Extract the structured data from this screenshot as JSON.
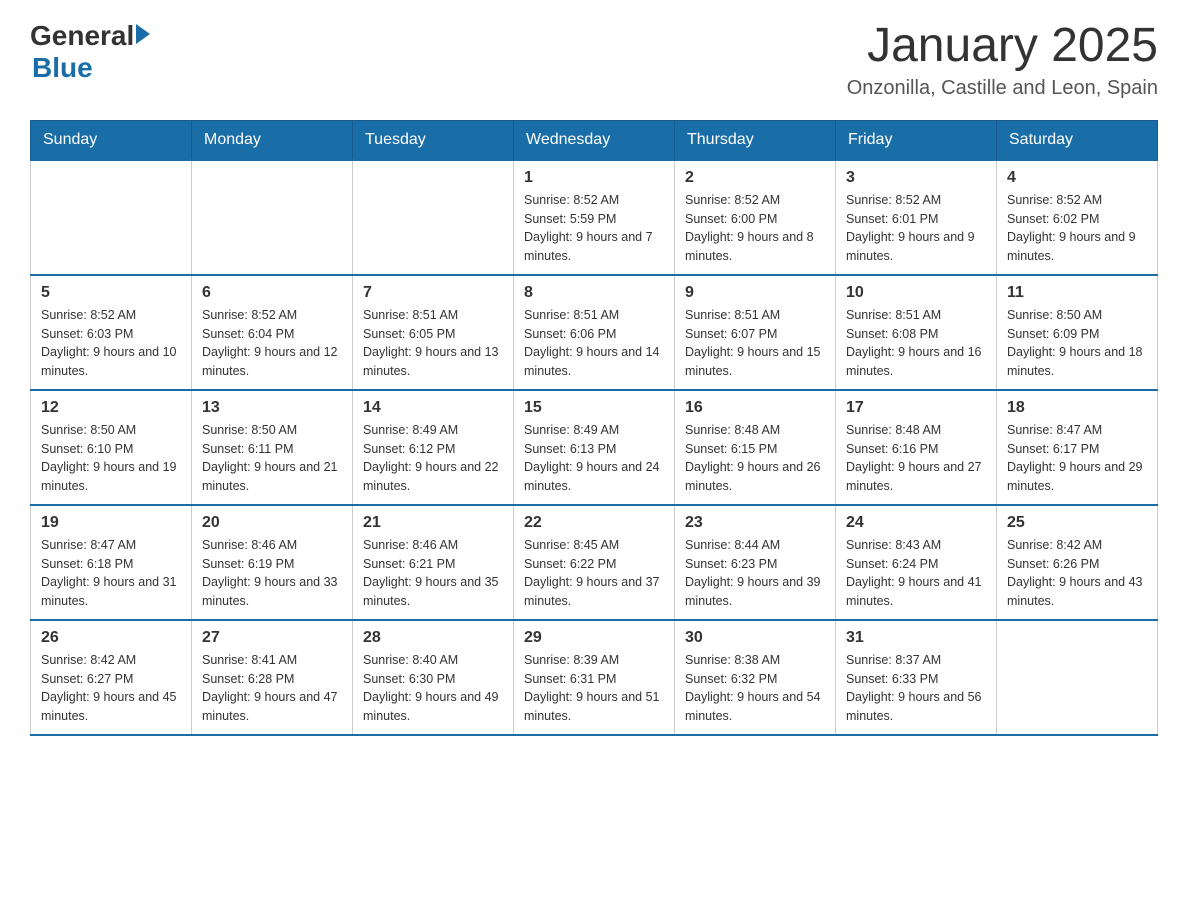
{
  "header": {
    "logo_general": "General",
    "logo_blue": "Blue",
    "title": "January 2025",
    "subtitle": "Onzonilla, Castille and Leon, Spain"
  },
  "days_of_week": [
    "Sunday",
    "Monday",
    "Tuesday",
    "Wednesday",
    "Thursday",
    "Friday",
    "Saturday"
  ],
  "weeks": [
    [
      {
        "date": "",
        "info": ""
      },
      {
        "date": "",
        "info": ""
      },
      {
        "date": "",
        "info": ""
      },
      {
        "date": "1",
        "info": "Sunrise: 8:52 AM\nSunset: 5:59 PM\nDaylight: 9 hours and 7 minutes."
      },
      {
        "date": "2",
        "info": "Sunrise: 8:52 AM\nSunset: 6:00 PM\nDaylight: 9 hours and 8 minutes."
      },
      {
        "date": "3",
        "info": "Sunrise: 8:52 AM\nSunset: 6:01 PM\nDaylight: 9 hours and 9 minutes."
      },
      {
        "date": "4",
        "info": "Sunrise: 8:52 AM\nSunset: 6:02 PM\nDaylight: 9 hours and 9 minutes."
      }
    ],
    [
      {
        "date": "5",
        "info": "Sunrise: 8:52 AM\nSunset: 6:03 PM\nDaylight: 9 hours and 10 minutes."
      },
      {
        "date": "6",
        "info": "Sunrise: 8:52 AM\nSunset: 6:04 PM\nDaylight: 9 hours and 12 minutes."
      },
      {
        "date": "7",
        "info": "Sunrise: 8:51 AM\nSunset: 6:05 PM\nDaylight: 9 hours and 13 minutes."
      },
      {
        "date": "8",
        "info": "Sunrise: 8:51 AM\nSunset: 6:06 PM\nDaylight: 9 hours and 14 minutes."
      },
      {
        "date": "9",
        "info": "Sunrise: 8:51 AM\nSunset: 6:07 PM\nDaylight: 9 hours and 15 minutes."
      },
      {
        "date": "10",
        "info": "Sunrise: 8:51 AM\nSunset: 6:08 PM\nDaylight: 9 hours and 16 minutes."
      },
      {
        "date": "11",
        "info": "Sunrise: 8:50 AM\nSunset: 6:09 PM\nDaylight: 9 hours and 18 minutes."
      }
    ],
    [
      {
        "date": "12",
        "info": "Sunrise: 8:50 AM\nSunset: 6:10 PM\nDaylight: 9 hours and 19 minutes."
      },
      {
        "date": "13",
        "info": "Sunrise: 8:50 AM\nSunset: 6:11 PM\nDaylight: 9 hours and 21 minutes."
      },
      {
        "date": "14",
        "info": "Sunrise: 8:49 AM\nSunset: 6:12 PM\nDaylight: 9 hours and 22 minutes."
      },
      {
        "date": "15",
        "info": "Sunrise: 8:49 AM\nSunset: 6:13 PM\nDaylight: 9 hours and 24 minutes."
      },
      {
        "date": "16",
        "info": "Sunrise: 8:48 AM\nSunset: 6:15 PM\nDaylight: 9 hours and 26 minutes."
      },
      {
        "date": "17",
        "info": "Sunrise: 8:48 AM\nSunset: 6:16 PM\nDaylight: 9 hours and 27 minutes."
      },
      {
        "date": "18",
        "info": "Sunrise: 8:47 AM\nSunset: 6:17 PM\nDaylight: 9 hours and 29 minutes."
      }
    ],
    [
      {
        "date": "19",
        "info": "Sunrise: 8:47 AM\nSunset: 6:18 PM\nDaylight: 9 hours and 31 minutes."
      },
      {
        "date": "20",
        "info": "Sunrise: 8:46 AM\nSunset: 6:19 PM\nDaylight: 9 hours and 33 minutes."
      },
      {
        "date": "21",
        "info": "Sunrise: 8:46 AM\nSunset: 6:21 PM\nDaylight: 9 hours and 35 minutes."
      },
      {
        "date": "22",
        "info": "Sunrise: 8:45 AM\nSunset: 6:22 PM\nDaylight: 9 hours and 37 minutes."
      },
      {
        "date": "23",
        "info": "Sunrise: 8:44 AM\nSunset: 6:23 PM\nDaylight: 9 hours and 39 minutes."
      },
      {
        "date": "24",
        "info": "Sunrise: 8:43 AM\nSunset: 6:24 PM\nDaylight: 9 hours and 41 minutes."
      },
      {
        "date": "25",
        "info": "Sunrise: 8:42 AM\nSunset: 6:26 PM\nDaylight: 9 hours and 43 minutes."
      }
    ],
    [
      {
        "date": "26",
        "info": "Sunrise: 8:42 AM\nSunset: 6:27 PM\nDaylight: 9 hours and 45 minutes."
      },
      {
        "date": "27",
        "info": "Sunrise: 8:41 AM\nSunset: 6:28 PM\nDaylight: 9 hours and 47 minutes."
      },
      {
        "date": "28",
        "info": "Sunrise: 8:40 AM\nSunset: 6:30 PM\nDaylight: 9 hours and 49 minutes."
      },
      {
        "date": "29",
        "info": "Sunrise: 8:39 AM\nSunset: 6:31 PM\nDaylight: 9 hours and 51 minutes."
      },
      {
        "date": "30",
        "info": "Sunrise: 8:38 AM\nSunset: 6:32 PM\nDaylight: 9 hours and 54 minutes."
      },
      {
        "date": "31",
        "info": "Sunrise: 8:37 AM\nSunset: 6:33 PM\nDaylight: 9 hours and 56 minutes."
      },
      {
        "date": "",
        "info": ""
      }
    ]
  ]
}
